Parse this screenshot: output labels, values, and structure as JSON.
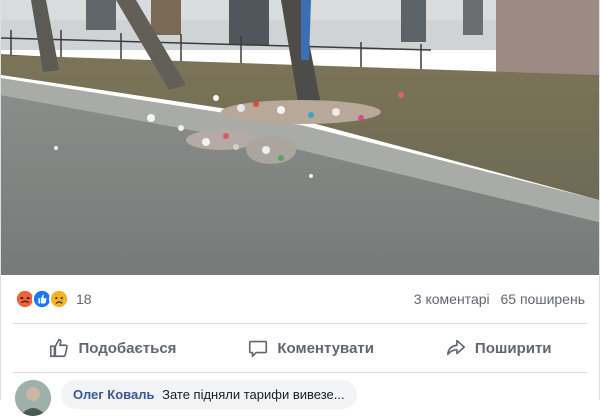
{
  "post": {
    "photo_alt": "Street with litter piled by a curb near a tree and a fence",
    "reactions": {
      "icons": [
        "angry-reaction-icon",
        "like-reaction-icon",
        "sad-reaction-icon"
      ],
      "count": "18"
    },
    "stats": {
      "comments": "3 коментарі",
      "shares": "65 поширень"
    },
    "actions": {
      "like": "Подобається",
      "comment": "Коментувати",
      "share": "Поширити"
    },
    "comment": {
      "author": "Олег Коваль",
      "text": "Зате підняли тарифи вивезе..."
    }
  },
  "colors": {
    "link": "#385898",
    "muted": "#606770",
    "like_blue": "#1877f2",
    "angry_orange": "#f0623a",
    "sad_yellow": "#f7b125"
  }
}
